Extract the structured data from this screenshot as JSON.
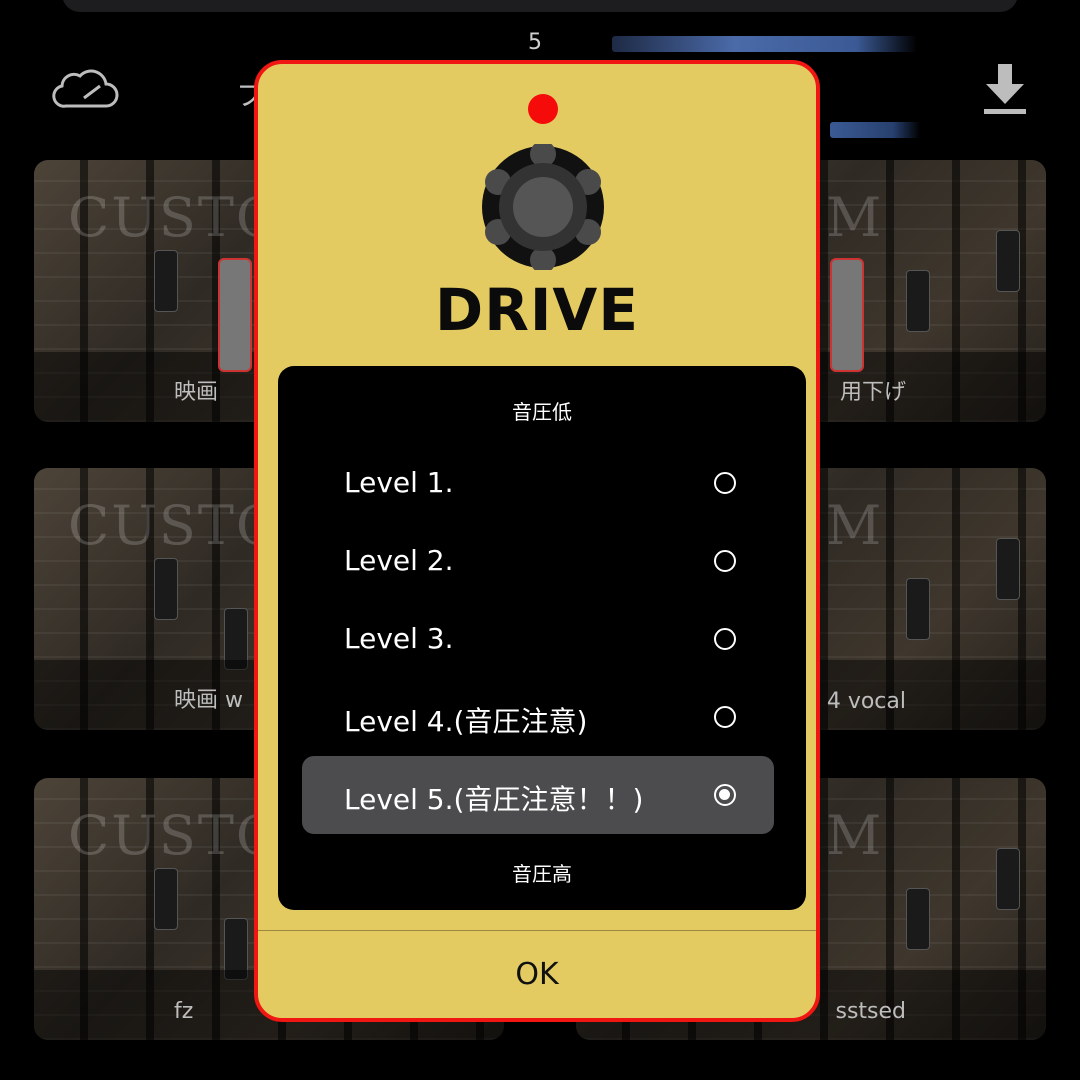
{
  "background": {
    "page_number": "5",
    "nav_partial": "フ",
    "tiles": [
      {
        "title": "CUSTO",
        "label": "映画",
        "side": "left"
      },
      {
        "title": "M",
        "label": "用下げ",
        "side": "right"
      },
      {
        "title": "CUSTO",
        "label": "映画 w",
        "side": "left"
      },
      {
        "title": "M",
        "label": "4 vocal",
        "side": "right"
      },
      {
        "title": "CUSTO",
        "label": "fz",
        "side": "left"
      },
      {
        "title": "M",
        "label": "sstsed",
        "side": "right"
      }
    ]
  },
  "dialog": {
    "pedal_name": "DRIVE",
    "led_color": "#f60b0b",
    "accent_color": "#e3cb62",
    "border_color": "#f01612",
    "hint_low": "音圧低",
    "hint_high": "音圧高",
    "options": [
      {
        "label": "Level 1.",
        "selected": false
      },
      {
        "label": "Level 2.",
        "selected": false
      },
      {
        "label": "Level 3.",
        "selected": false
      },
      {
        "label": " Level 4.(音圧注意)",
        "selected": false
      },
      {
        "label": " Level 5.(音圧注意！！)",
        "selected": true
      }
    ],
    "ok_label": "OK"
  },
  "icons": [
    "cloud-icon",
    "download-icon",
    "knob-icon",
    "radio-icon"
  ]
}
